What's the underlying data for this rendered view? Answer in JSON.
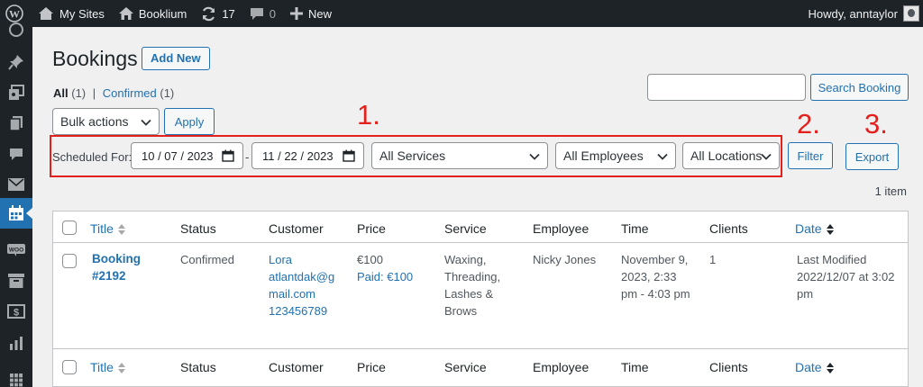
{
  "adminbar": {
    "my_sites": "My Sites",
    "site_name": "Booklium",
    "updates_count": "17",
    "comments_count": "0",
    "new_label": "New",
    "howdy": "Howdy, anntaylor"
  },
  "sidebar": {
    "items": [
      "dashboard-icon",
      "pin-icon",
      "media-icon",
      "pages-icon",
      "comments-icon",
      "mail-icon",
      "calendar-icon",
      "woo-icon",
      "archive-icon",
      "money-icon",
      "chart-icon",
      "grid-icon"
    ],
    "active": "calendar-icon"
  },
  "page": {
    "title": "Bookings",
    "add_new": "Add New"
  },
  "views": {
    "all_label": "All",
    "all_count": "(1)",
    "separator": "|",
    "confirmed_label": "Confirmed",
    "confirmed_count": "(1)"
  },
  "search": {
    "value": "",
    "button": "Search Booking"
  },
  "bulk": {
    "selected": "Bulk actions",
    "apply": "Apply"
  },
  "filters": {
    "scheduled_label": "Scheduled For:",
    "date_from": "10 / 07 / 2023",
    "date_separator": "-",
    "date_to": "11 / 22 / 2023",
    "services": "All Services",
    "employees": "All Employees",
    "locations": "All Locations",
    "filter": "Filter",
    "export": "Export"
  },
  "annotations": [
    "1.",
    "2.",
    "3."
  ],
  "item_count": "1 item",
  "table": {
    "columns": [
      "Title",
      "Status",
      "Customer",
      "Price",
      "Service",
      "Employee",
      "Time",
      "Clients",
      "Date"
    ],
    "rows": [
      {
        "title": [
          "Booking",
          "#2192"
        ],
        "status": "Confirmed",
        "customer": [
          "Lora",
          "atlantdak@g",
          "mail.com",
          "123456789"
        ],
        "price": [
          "€100",
          "Paid: €100"
        ],
        "service": [
          "Waxing,",
          "Threading,",
          "Lashes &",
          "Brows"
        ],
        "employee": "Nicky Jones",
        "time": [
          "November 9,",
          "2023, 2:33",
          "pm - 4:03 pm"
        ],
        "clients": "1",
        "date": [
          "Last Modified",
          "2022/12/07 at 3:02",
          "pm"
        ]
      }
    ]
  },
  "colors": {
    "adminbar_bg": "#1d2327",
    "accent": "#2271b1",
    "annotation": "#e3201b",
    "page_bg": "#f0f0f1"
  }
}
